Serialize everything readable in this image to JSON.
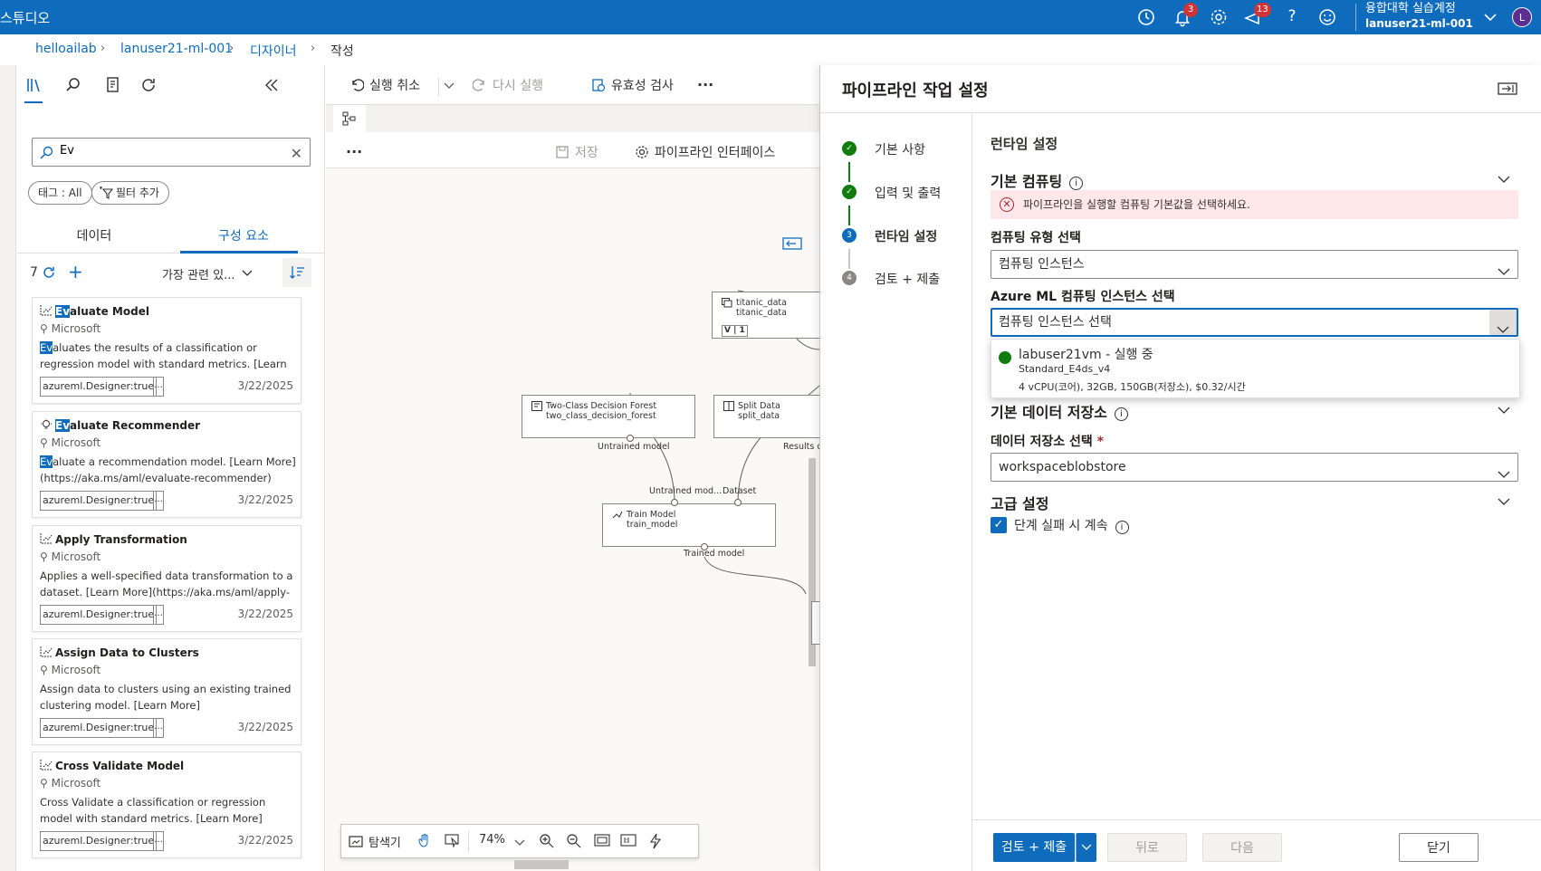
{
  "topbar": {
    "brand": "스튜디오",
    "notification_count": "3",
    "feedback_count": "13",
    "account_org": "융합대학 실습계정",
    "account_user": "lanuser21-ml-001",
    "avatar_initial": "L"
  },
  "breadcrumb": {
    "items": [
      "helloailab",
      "lanuser21-ml-001",
      "디자이너",
      "작성"
    ]
  },
  "left_panel": {
    "search_value": "Ev",
    "tag_filter": "태그 : All",
    "add_filter": "필터 추가",
    "tabs": [
      "데이터",
      "구성 요소"
    ],
    "active_tab": "구성 요소",
    "result_count": "7",
    "sort_label": "가장 관련 있...",
    "cards": [
      {
        "title_hl": "Ev",
        "title_rest": "aluate Model",
        "author": "Microsoft",
        "desc_hl": "Ev",
        "desc_rest": "aluates the results of a classification or regression model with standard metrics. [Learn More](https://...",
        "tag": "azureml.Designer:true",
        "more": "...",
        "date": "3/22/2025"
      },
      {
        "title_hl": "Ev",
        "title_rest": "aluate Recommender",
        "author": "Microsoft",
        "desc_hl": "Ev",
        "desc_rest": "aluate a recommendation model. [Learn More](https://aka.ms/aml/evaluate-recommender)",
        "tag": "azureml.Designer:true",
        "more": "...",
        "date": "3/22/2025"
      },
      {
        "title_hl": "",
        "title_rest": "Apply Transformation",
        "author": "Microsoft",
        "desc_hl": "",
        "desc_rest": "Applies a well-specified data transformation to a dataset. [Learn More](https://aka.ms/aml/apply-tra...",
        "tag": "azureml.Designer:true",
        "more": "...",
        "date": "3/22/2025"
      },
      {
        "title_hl": "",
        "title_rest": "Assign Data to Clusters",
        "author": "Microsoft",
        "desc_hl": "",
        "desc_rest": "Assign data to clusters using an existing trained clustering model. [Learn More](https://aka.ms/aml/...",
        "tag": "azureml.Designer:true",
        "more": "...",
        "date": "3/22/2025"
      },
      {
        "title_hl": "",
        "title_rest": "Cross Validate Model",
        "author": "Microsoft",
        "desc_hl": "",
        "desc_rest": "Cross Validate a classification or regression model with standard metrics. [Learn More](https://aka.ms/...",
        "tag": "azureml.Designer:true",
        "more": "...",
        "date": "3/22/2025"
      }
    ]
  },
  "canvas": {
    "undo": "실행 취소",
    "redo": "다시 실행",
    "validate": "유효성 검사",
    "more": "...",
    "save": "저장",
    "pipeline_interface": "파이프라인 인터페이스",
    "nodes": {
      "titanic_title": "titanic_data",
      "titanic_sub": "titanic_data",
      "titanic_ver": "V | 1",
      "forest_title": "Two-Class Decision Forest",
      "forest_sub": "two_class_decision_forest",
      "split_title": "Split Data",
      "split_sub": "split_data",
      "train_title": "Train Model",
      "train_sub": "train_model"
    },
    "ports": {
      "untrained_model": "Untrained model",
      "results": "Results d",
      "untrained_mod": "Untrained mod...",
      "dataset": "Dataset",
      "trained_model": "Trained model"
    },
    "bottom": {
      "explorer": "탐색기",
      "zoom": "74%"
    }
  },
  "settings": {
    "title": "파이프라인 작업 설정",
    "steps": [
      {
        "num": "",
        "label": "기본 사항",
        "state": "done"
      },
      {
        "num": "",
        "label": "입력 및 출력",
        "state": "done"
      },
      {
        "num": "3",
        "label": "런타임 설정",
        "state": "current"
      },
      {
        "num": "4",
        "label": "검토 + 제출",
        "state": "todo"
      }
    ],
    "content_title": "런타임 설정",
    "default_compute": "기본 컴퓨팅",
    "error_text": "파이프라인을 실행할 컴퓨팅 기본값을 선택하세요.",
    "compute_type_label": "컴퓨팅 유형 선택",
    "compute_type_value": "컴퓨팅 인스턴스",
    "instance_label": "Azure ML 컴퓨팅 인스턴스 선택",
    "instance_placeholder": "컴퓨팅 인스턴스 선택",
    "instance_option": {
      "name": "labuser21vm - 실행 중",
      "size": "Standard_E4ds_v4",
      "spec": "4 vCPU(코어), 32GB, 150GB(저장소), $0.32/시간"
    },
    "default_datastore": "기본 데이터 저장소",
    "datastore_label": "데이터 저장소 선택",
    "datastore_required": "*",
    "datastore_value": "workspaceblobstore",
    "advanced": "고급 설정",
    "continue_on_fail": "단계 실패 시 계속",
    "buttons": {
      "submit": "검토 + 제출",
      "back": "뒤로",
      "next": "다음",
      "close": "닫기"
    }
  },
  "colors": {
    "accent": "#0f6cbd",
    "success": "#107c10",
    "error_bg": "#fde7e9"
  }
}
